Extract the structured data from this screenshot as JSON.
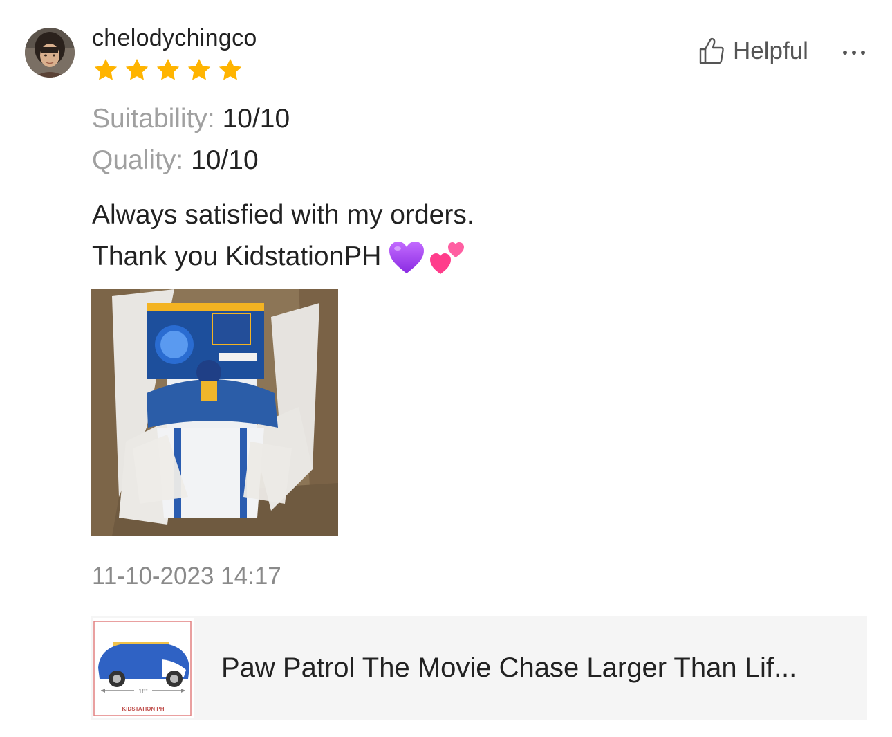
{
  "review": {
    "username": "chelodychingco",
    "rating": 5,
    "rating_max": 5,
    "star_color": "#ffb400",
    "helpful_label": "Helpful",
    "more_icon": "more-horizontal-icon",
    "attributes": [
      {
        "label": "Suitability:",
        "value": "10/10"
      },
      {
        "label": "Quality:",
        "value": "10/10"
      }
    ],
    "comment_lines": [
      "Always satisfied with my orders.",
      "Thank you KidstationPH"
    ],
    "comment_emojis": [
      "purple-heart-icon",
      "two-hearts-icon"
    ],
    "photo_icon": "review-photo",
    "timestamp": "11-10-2023 14:17"
  },
  "product": {
    "title": "Paw Patrol The Movie Chase Larger Than Lif...",
    "thumb_size_label": "18\"",
    "thumb_brand": "KIDSTATION PH"
  }
}
